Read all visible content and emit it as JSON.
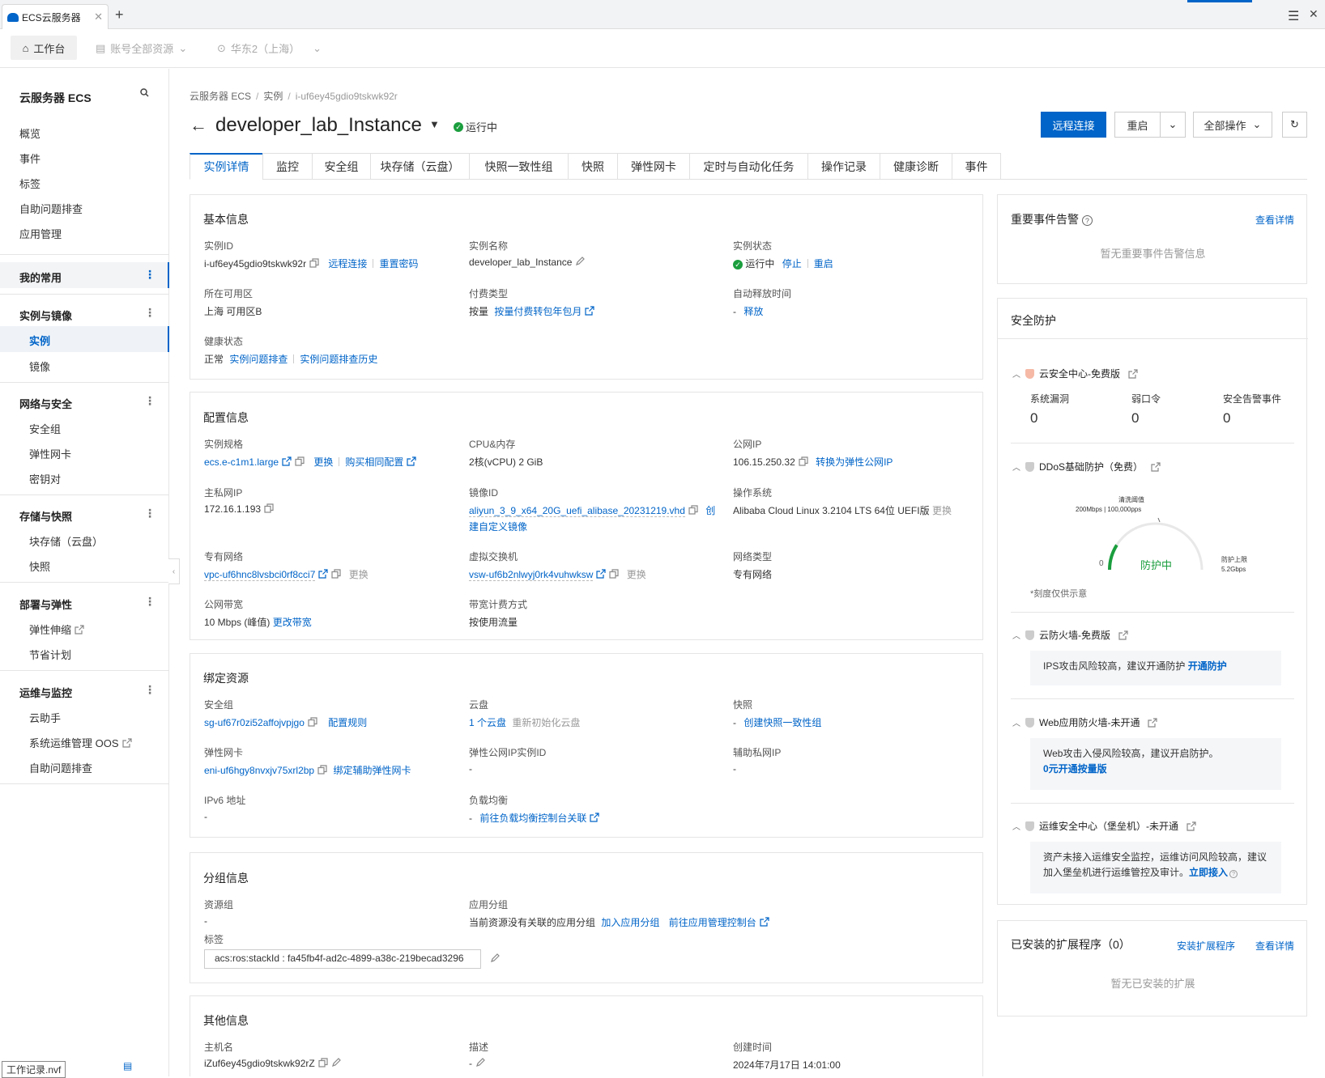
{
  "browser": {
    "tab_title": "ECS云服务器",
    "new_tab": "+",
    "menu": "☰",
    "close": "✕"
  },
  "topbar": {
    "workbench": "工作台",
    "account": "账号全部资源",
    "region": "华东2（上海）"
  },
  "sidebar": {
    "title": "云服务器 ECS",
    "top_items": [
      "概览",
      "事件",
      "标签",
      "自助问题排查",
      "应用管理"
    ],
    "favorites": "我的常用",
    "groups": [
      {
        "label": "实例与镜像",
        "items": [
          "实例",
          "镜像"
        ]
      },
      {
        "label": "网络与安全",
        "items": [
          "安全组",
          "弹性网卡",
          "密钥对"
        ]
      },
      {
        "label": "存储与快照",
        "items": [
          "块存储（云盘）",
          "快照"
        ]
      },
      {
        "label": "部署与弹性",
        "items": [
          "弹性伸缩",
          "节省计划"
        ]
      },
      {
        "label": "运维与监控",
        "items": [
          "云助手",
          "系统运维管理 OOS",
          "自助问题排查"
        ]
      }
    ],
    "file_tip": "工作记录.nvf"
  },
  "breadcrumb": [
    "云服务器 ECS",
    "实例",
    "i-uf6ey45gdio9tskwk92r"
  ],
  "header": {
    "title": "developer_lab_Instance",
    "status": "运行中",
    "buttons": {
      "remote": "远程连接",
      "restart": "重启",
      "all_ops": "全部操作"
    }
  },
  "tabs": [
    "实例详情",
    "监控",
    "安全组",
    "块存储（云盘）",
    "快照一致性组",
    "快照",
    "弹性网卡",
    "定时与自动化任务",
    "操作记录",
    "健康诊断",
    "事件"
  ],
  "basic": {
    "title": "基本信息",
    "instance_id_label": "实例ID",
    "instance_id": "i-uf6ey45gdio9tskwk92r",
    "remote": "远程连接",
    "reset_pwd": "重置密码",
    "name_label": "实例名称",
    "name": "developer_lab_Instance",
    "state_label": "实例状态",
    "state": "运行中",
    "stop": "停止",
    "restart": "重启",
    "zone_label": "所在可用区",
    "zone": "上海 可用区B",
    "pay_label": "付费类型",
    "pay": "按量",
    "pay_link": "按量付费转包年包月",
    "release_label": "自动释放时间",
    "release_dash": "-",
    "release_link": "释放",
    "health_label": "健康状态",
    "health": "正常",
    "health_link1": "实例问题排查",
    "health_link2": "实例问题排查历史"
  },
  "config": {
    "title": "配置信息",
    "spec_label": "实例规格",
    "spec": "ecs.e-c1m1.large",
    "spec_change": "更换",
    "spec_buy": "购买相同配置",
    "cpu_label": "CPU&内存",
    "cpu": "2核(vCPU)  2 GiB",
    "pubip_label": "公网IP",
    "pubip": "106.15.250.32",
    "pubip_link": "转换为弹性公网IP",
    "privip_label": "主私网IP",
    "privip": "172.16.1.193",
    "image_label": "镜像ID",
    "image": "aliyun_3_9_x64_20G_uefi_alibase_20231219.vhd",
    "image_link_a": "创",
    "image_link_b": "建自定义镜像",
    "os_label": "操作系统",
    "os": "Alibaba Cloud Linux 3.2104 LTS 64位 UEFI版",
    "os_change": "更换",
    "vpc_label": "专有网络",
    "vpc": "vpc-uf6hnc8lvsbci0rf8cci7",
    "vpc_change": "更换",
    "vsw_label": "虚拟交换机",
    "vsw": "vsw-uf6b2nlwyj0rk4vuhwksw",
    "vsw_change": "更换",
    "nettype_label": "网络类型",
    "nettype": "专有网络",
    "bw_label": "公网带宽",
    "bw": "10 Mbps (峰值)",
    "bw_link": "更改带宽",
    "bwpay_label": "带宽计费方式",
    "bwpay": "按使用流量"
  },
  "bound": {
    "title": "绑定资源",
    "sg_label": "安全组",
    "sg": "sg-uf67r0zi52affojvpjgo",
    "sg_link": "配置规则",
    "disk_label": "云盘",
    "disk": "1 个云盘",
    "disk_gray": "重新初始化云盘",
    "snap_label": "快照",
    "snap_dash": "-",
    "snap_link": "创建快照一致性组",
    "eni_label": "弹性网卡",
    "eni": "eni-uf6hgy8nvxjv75xrl2bp",
    "eni_link": "绑定辅助弹性网卡",
    "eip_label": "弹性公网IP实例ID",
    "eip": "-",
    "secip_label": "辅助私网IP",
    "secip": "-",
    "ipv6_label": "IPv6 地址",
    "ipv6": "-",
    "lb_label": "负载均衡",
    "lb_dash": "-",
    "lb_link": "前往负载均衡控制台关联"
  },
  "group": {
    "title": "分组信息",
    "rg_label": "资源组",
    "rg": "-",
    "app_label": "应用分组",
    "app": "当前资源没有关联的应用分组",
    "app_link1": "加入应用分组",
    "app_link2": "前往应用管理控制台",
    "tag_label": "标签",
    "tag": "acs:ros:stackId : fa45fb4f-ad2c-4899-a38c-219becad3296"
  },
  "other": {
    "title": "其他信息",
    "host_label": "主机名",
    "host": "iZuf6ey45gdio9tskwk92rZ",
    "desc_label": "描述",
    "desc": "-",
    "created_label": "创建时间",
    "created": "2024年7月17日 14:01:00"
  },
  "events": {
    "title": "重要事件告警",
    "link": "查看详情",
    "empty": "暂无重要事件告警信息"
  },
  "security": {
    "title": "安全防护",
    "center": {
      "title": "云安全中心-免费版",
      "stats": [
        {
          "label": "系统漏洞",
          "value": "0"
        },
        {
          "label": "弱口令",
          "value": "0"
        },
        {
          "label": "安全告警事件",
          "value": "0"
        }
      ]
    },
    "ddos": {
      "title": "DDoS基础防护（免费）",
      "clean_label": "清洗阈值",
      "clean_value": "200Mbps | 100,000pps",
      "zero": "0",
      "state": "防护中",
      "cap_label": "防护上限",
      "cap_value": "5.2Gbps",
      "note": "*刻度仅供示意",
      "level": 0.18
    },
    "firewall": {
      "title": "云防火墙-免费版",
      "text": "IPS攻击风险较高，建议开通防护",
      "link": "开通防护"
    },
    "waf": {
      "title": "Web应用防火墙-未开通",
      "text": "Web攻击入侵风险较高，建议开启防护。",
      "link": "0元开通按量版"
    },
    "bastion": {
      "title": "运维安全中心（堡垒机）-未开通",
      "text": "资产未接入运维安全监控，运维访问风险较高，建议加入堡垒机进行运维管控及审计。",
      "link": "立即接入"
    }
  },
  "extensions": {
    "title": "已安装的扩展程序（0）",
    "install": "安装扩展程序",
    "details": "查看详情",
    "empty": "暂无已安装的扩展"
  }
}
